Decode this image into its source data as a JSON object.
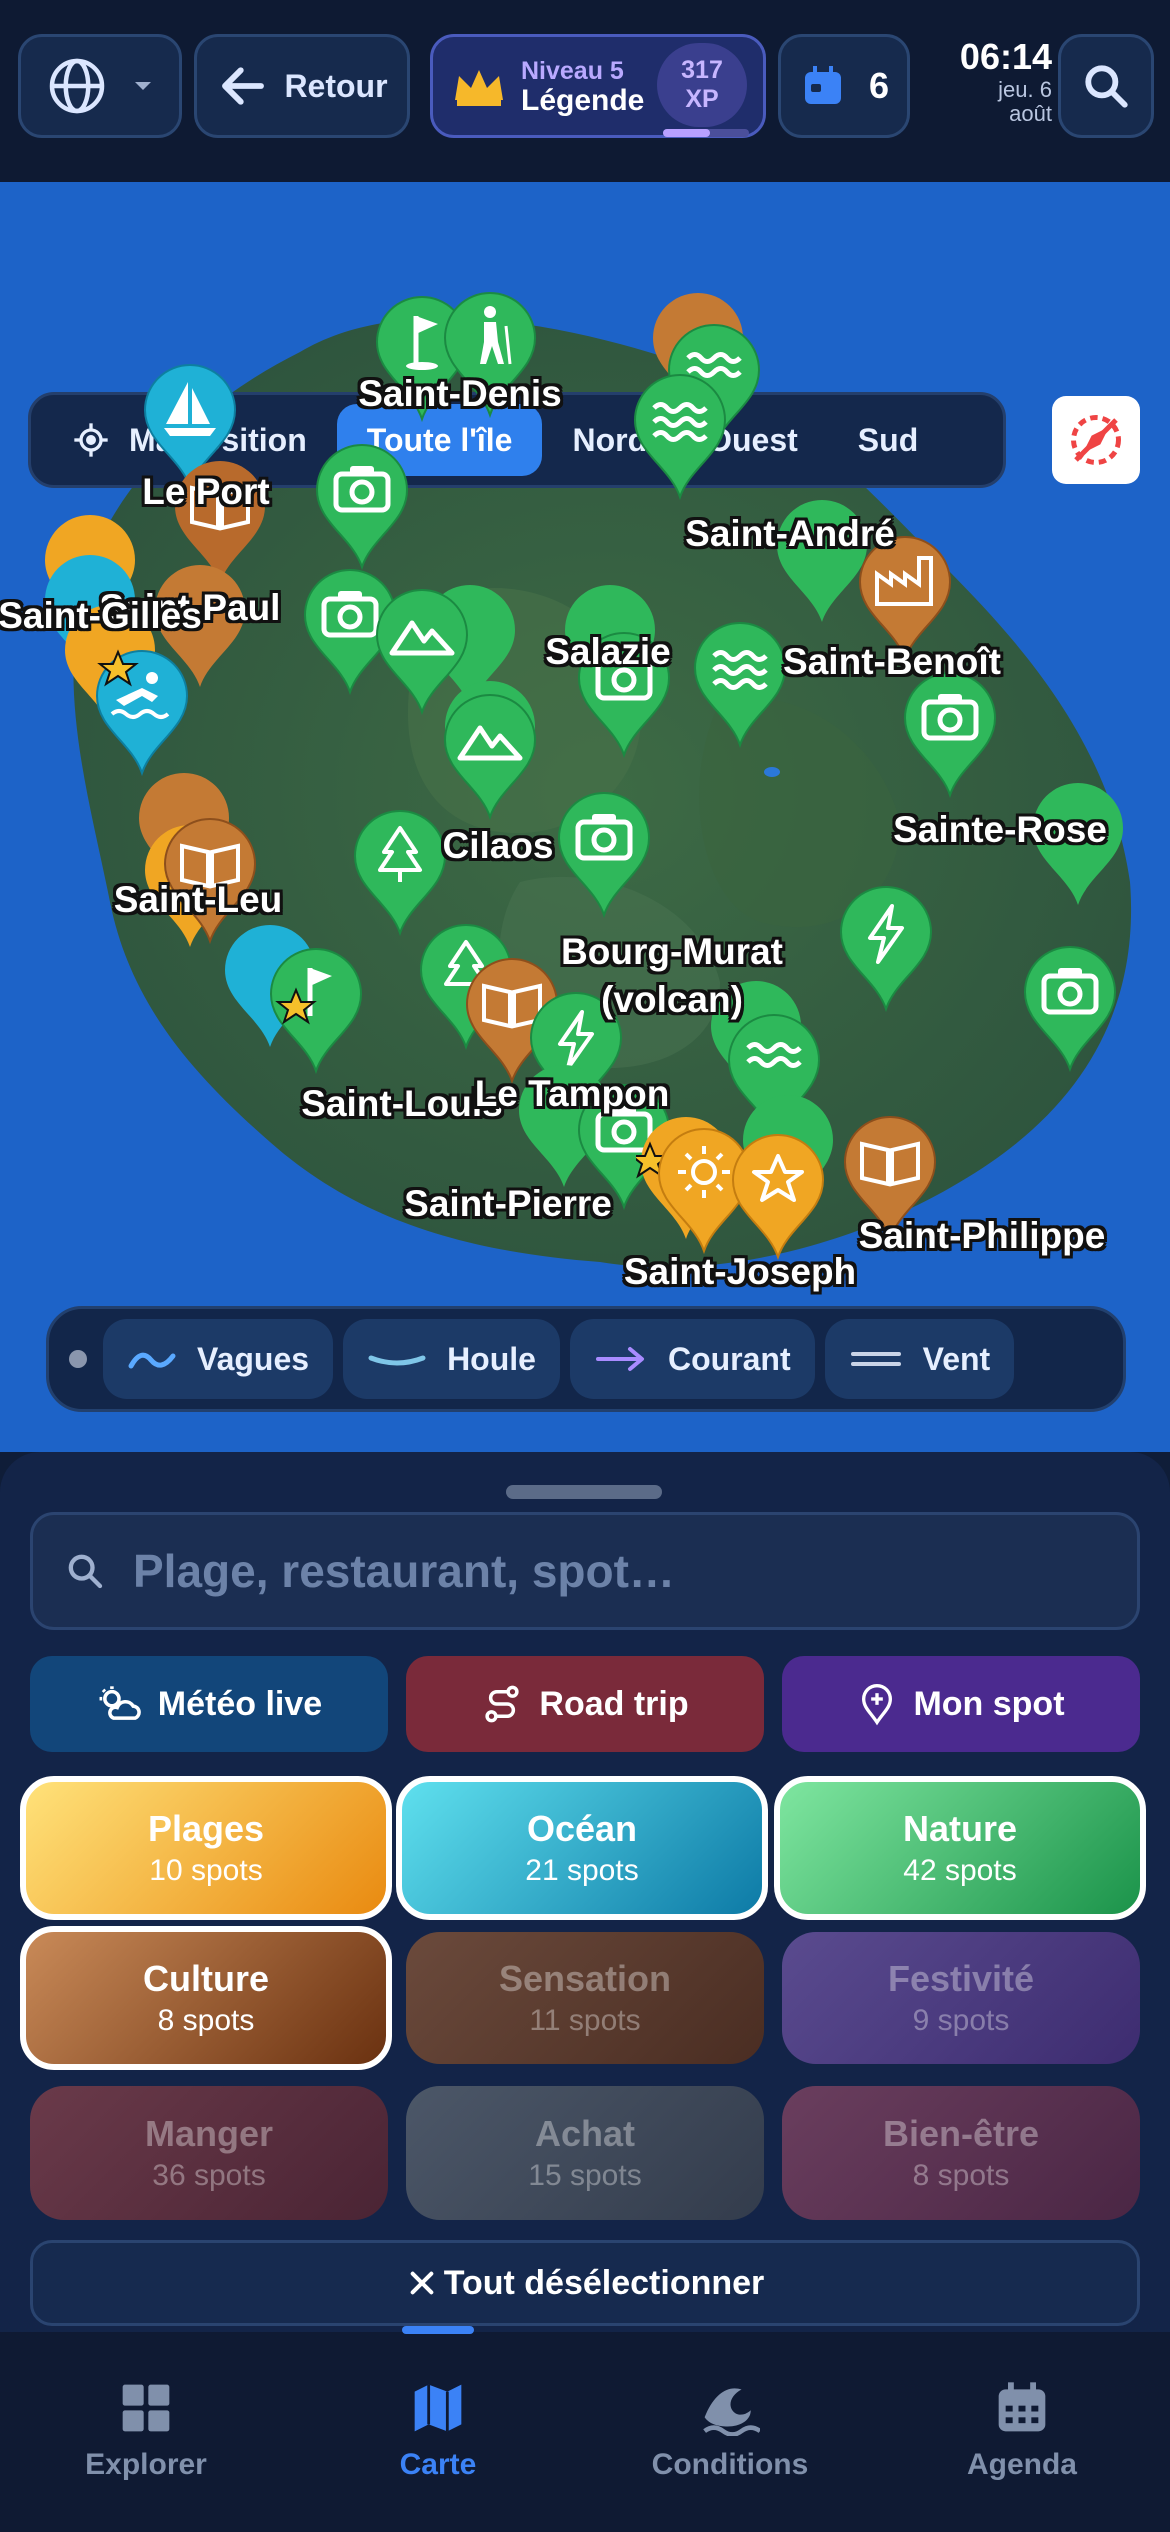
{
  "topbar": {
    "language_icon": "globe-icon",
    "back_label": "Retour",
    "level_label": "Niveau 5",
    "rank_label": "Légende",
    "xp_value": "317",
    "xp_unit": "XP",
    "xp_progress": 0.55,
    "calendar_count": "6",
    "time": "06:14",
    "date_line1": "jeu. 6",
    "date_line2": "août"
  },
  "map": {
    "regions": [
      "Ma position",
      "Toute l'île",
      "Nord",
      "Ouest",
      "Sud"
    ],
    "active_region": "Toute l'île",
    "cities": {
      "saint_denis": "Saint-Denis",
      "le_port": "Le Port",
      "saint_paul": "Saint-Paul",
      "saint_gilles": "Saint-Gilles",
      "saint_andre": "Saint-André",
      "salazie": "Salazie",
      "saint_benoit": "Saint-Benoît",
      "sainte_rose": "Sainte-Rose",
      "cilaos": "Cilaos",
      "saint_leu": "Saint-Leu",
      "bourg_murat_1": "Bourg-Murat",
      "bourg_murat_2": "(volcan)",
      "saint_louis": "Saint-Louis",
      "le_tampon": "Le Tampon",
      "saint_pierre": "Saint-Pierre",
      "saint_joseph": "Saint-Joseph",
      "saint_philippe": "Saint-Philippe"
    },
    "layers": [
      "Vagues",
      "Houle",
      "Courant",
      "Vent"
    ]
  },
  "search": {
    "placeholder": "Plage, restaurant, spot…"
  },
  "quick_actions": [
    "Météo live",
    "Road trip",
    "Mon spot"
  ],
  "categories": [
    {
      "name": "Plages",
      "count": "10 spots",
      "selected": true
    },
    {
      "name": "Océan",
      "count": "21 spots",
      "selected": true
    },
    {
      "name": "Nature",
      "count": "42 spots",
      "selected": true
    },
    {
      "name": "Culture",
      "count": "8 spots",
      "selected": true
    },
    {
      "name": "Sensation",
      "count": "11 spots",
      "selected": false
    },
    {
      "name": "Festivité",
      "count": "9 spots",
      "selected": false
    },
    {
      "name": "Manger",
      "count": "36 spots",
      "selected": false
    },
    {
      "name": "Achat",
      "count": "15 spots",
      "selected": false
    },
    {
      "name": "Bien-être",
      "count": "8 spots",
      "selected": false
    }
  ],
  "deselect_label": "Tout désélectionner",
  "nav": [
    "Explorer",
    "Carte",
    "Conditions",
    "Agenda"
  ],
  "active_nav": "Carte",
  "colors": {
    "accent": "#3b82f6",
    "nature": "#2fb85b",
    "ocean": "#1fb1d6",
    "culture": "#b86a2c",
    "plages": "#f0a623"
  }
}
